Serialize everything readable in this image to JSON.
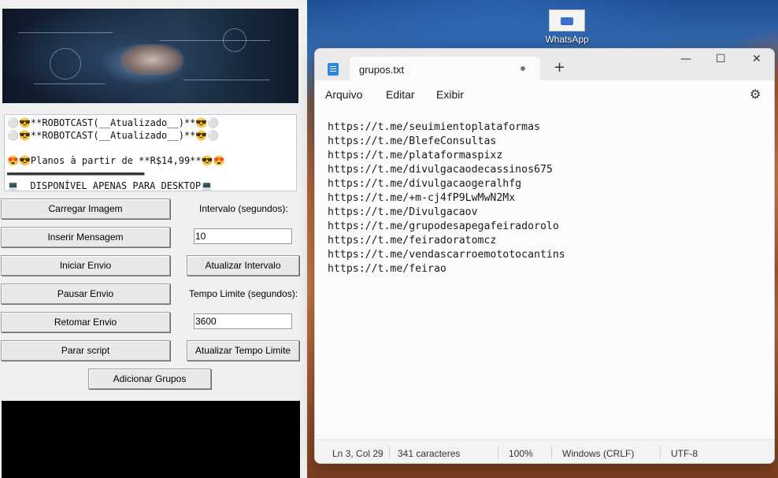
{
  "desktop": {
    "icon_label": "WhatsApp"
  },
  "app": {
    "message_lines": [
      "⚪😎**ROBOTCAST(__Atualizado__)**😎⚪",
      "⚪😎**ROBOTCAST(__Atualizado__)**😎⚪",
      "",
      "😍😎Planos à partir de **R$14,99**😎😍",
      "▬▬▬▬▬▬▬▬▬▬▬▬▬▬▬▬▬▬▬▬▬▬▬▬▬▬▬▬▬▬▬▬▬",
      "💻  DISPONÍVEL APENAS PARA DESKTOP💻"
    ],
    "buttons": {
      "load_image": "Carregar Imagem",
      "insert_message": "Inserir Mensagem",
      "start_send": "Iniciar Envio",
      "pause_send": "Pausar Envio",
      "resume_send": "Retomar Envio",
      "stop_script": "Parar script",
      "add_groups": "Adicionar Grupos",
      "update_interval": "Atualizar Intervalo",
      "update_time_limit": "Atualizar Tempo Limite"
    },
    "labels": {
      "interval": "Intervalo (segundos):",
      "time_limit": "Tempo Limite (segundos):"
    },
    "fields": {
      "interval_value": "10",
      "time_limit_value": "3600"
    }
  },
  "notepad": {
    "tab_title": "grupos.txt",
    "menu": [
      "Arquivo",
      "Editar",
      "Exibir"
    ],
    "lines": [
      "https://t.me/seuimientoplataformas",
      "https://t.me/BlefeConsultas",
      "https://t.me/plataformaspixz",
      "https://t.me/divulgacaodecassinos675",
      "https://t.me/divulgacaogeralhfg",
      "https://t.me/+m-cj4fP9LwMwN2Mx",
      "https://t.me/Divulgacaov",
      "https://t.me/grupodesapegafeiradorolo",
      "https://t.me/feiradoratomcz",
      "https://t.me/vendascarroemototocantins",
      "https://t.me/feirao"
    ],
    "status": {
      "position": "Ln 3, Col 29",
      "chars": "341 caracteres",
      "zoom": "100%",
      "line_endings": "Windows (CRLF)",
      "encoding": "UTF-8"
    }
  }
}
